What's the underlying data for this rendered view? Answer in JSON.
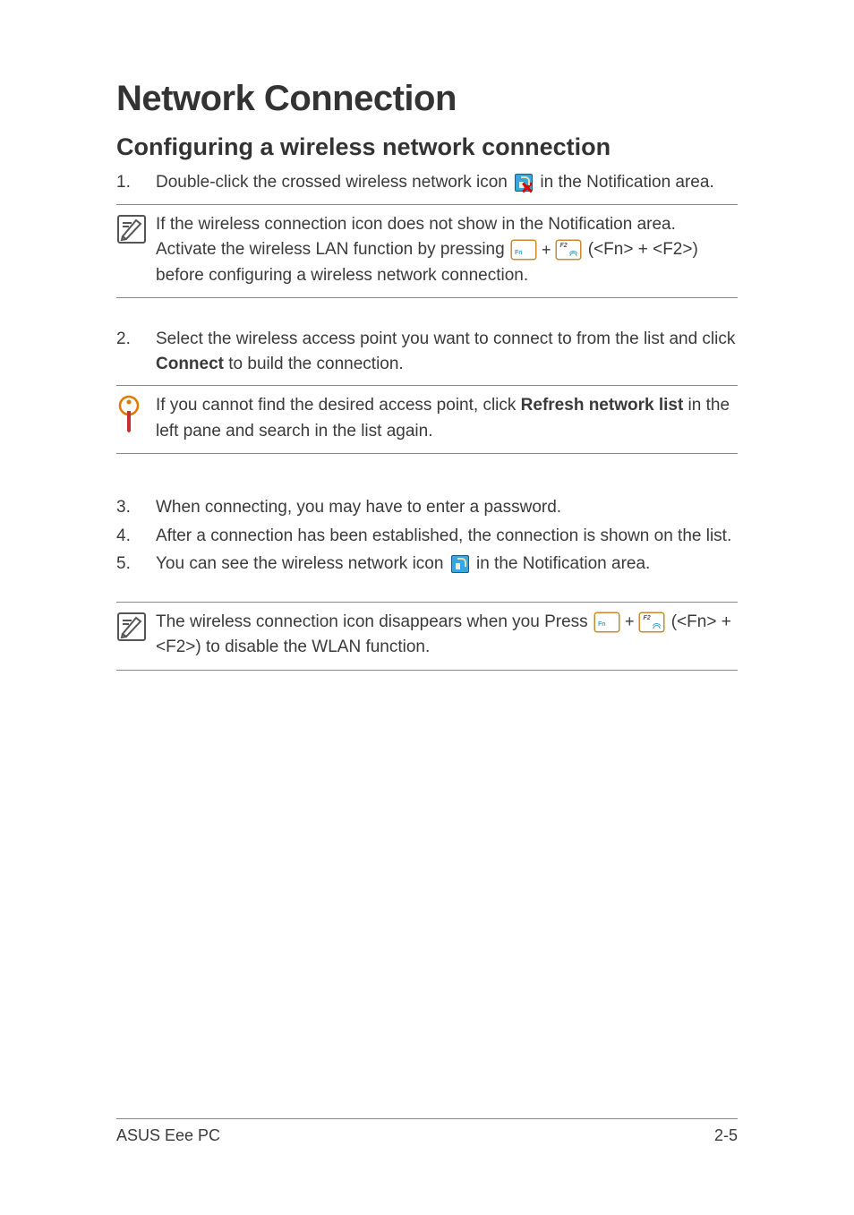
{
  "title": "Network Connection",
  "subtitle": "Configuring a wireless network connection",
  "steps": {
    "s1": {
      "num": "1.",
      "pre": "Double-click the crossed wireless network icon ",
      "post": " in the Notification area."
    },
    "note1": {
      "pre": "If the wireless connection icon does not show in the Notification area. Activate the wireless LAN function by pressing ",
      "post": " (<Fn> + <F2>) before configuring a wireless network connection."
    },
    "s2": {
      "num": "2.",
      "a": "Select the wireless access point you want to connect to from the list and click ",
      "b": "Connect",
      "c": " to build the connection."
    },
    "note2": {
      "a": "If you cannot find the desired access point, click ",
      "b": "Refresh network list",
      "c": " in the left pane and search in the list again."
    },
    "s3": {
      "num": "3.",
      "text": "When connecting, you may have to enter a password."
    },
    "s4": {
      "num": "4.",
      "text": "After a connection has been established, the connection is shown on the list."
    },
    "s5": {
      "num": "5.",
      "pre": "You can see the wireless network icon ",
      "post": " in the Notification area."
    },
    "note3": {
      "pre": "The wireless connection icon disappears when you Press ",
      "post": " (<Fn> + <F2>) to disable the WLAN function."
    }
  },
  "footer": {
    "left": "ASUS Eee PC",
    "right": "2-5"
  }
}
